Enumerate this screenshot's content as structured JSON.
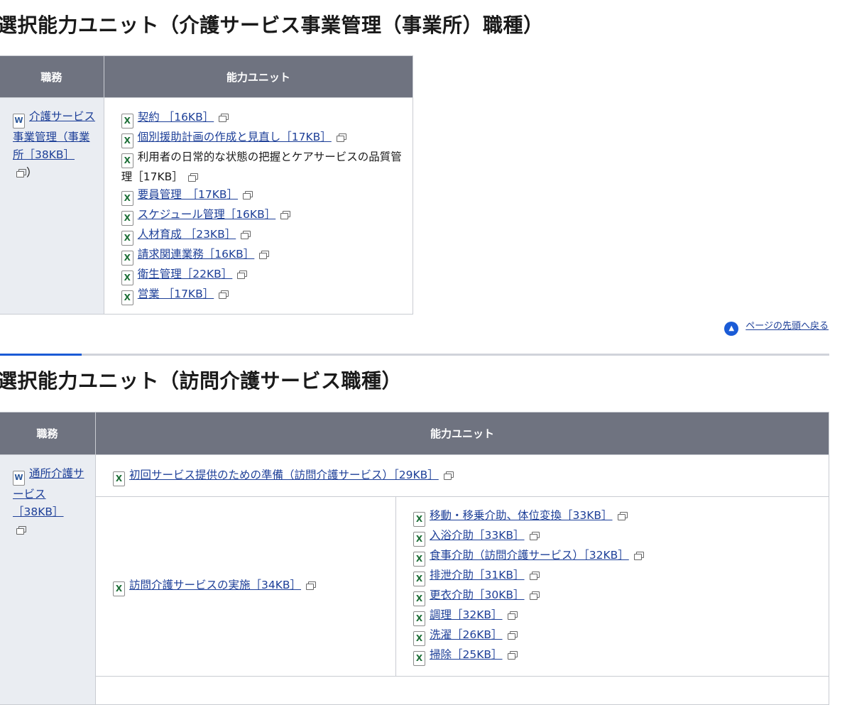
{
  "section1": {
    "heading": "選択能力ユニット（介護サービス事業管理（事業所）職種）",
    "col_job": "職務",
    "col_units": "能力ユニット",
    "job": {
      "label": "介護サービス事業管理（事業所［38KB］",
      "suffix": "）",
      "icon": "W"
    },
    "units": [
      {
        "label": "契約 ［16KB］"
      },
      {
        "label": "個別援助計画の作成と見直し［17KB］"
      },
      {
        "label": "利用者の日常的な状態の把握とケアサービスの品質管理［17KB］"
      },
      {
        "label": "要員管理　［17KB］"
      },
      {
        "label": "スケジュール管理［16KB］"
      },
      {
        "label": "人材育成 ［23KB］"
      },
      {
        "label": "請求関連業務［16KB］"
      },
      {
        "label": "衛生管理［22KB］"
      },
      {
        "label": "営業 ［17KB］"
      }
    ]
  },
  "page_top": "ページの先頭へ戻る",
  "section2": {
    "heading": "選択能力ユニット（訪問介護サービス職種）",
    "col_job": "職務",
    "col_units": "能力ユニット",
    "job": {
      "label": "通所介護サービス［38KB］",
      "icon": "W"
    },
    "first_unit": "初回サービス提供のための準備（訪問介護サービス）［29KB］",
    "main_unit": "訪問介護サービスの実施［34KB］",
    "sub_units": [
      {
        "label": "移動・移乗介助、体位変換［33KB］"
      },
      {
        "label": "入浴介助［33KB］"
      },
      {
        "label": "食事介助（訪問介護サービス）［32KB］"
      },
      {
        "label": "排泄介助［31KB］"
      },
      {
        "label": "更衣介助［30KB］"
      },
      {
        "label": "調理［32KB］"
      },
      {
        "label": "洗濯［26KB］"
      },
      {
        "label": "掃除［25KB］"
      }
    ]
  },
  "icons": {
    "excel": "X",
    "word": "W",
    "external": "external-window-icon",
    "page_top": "arrow-up-circle-icon"
  },
  "colors": {
    "header_bg": "#6f7380",
    "job_bg": "#eaedf2",
    "link": "#1d3f98",
    "accent": "#1a5bd6"
  }
}
